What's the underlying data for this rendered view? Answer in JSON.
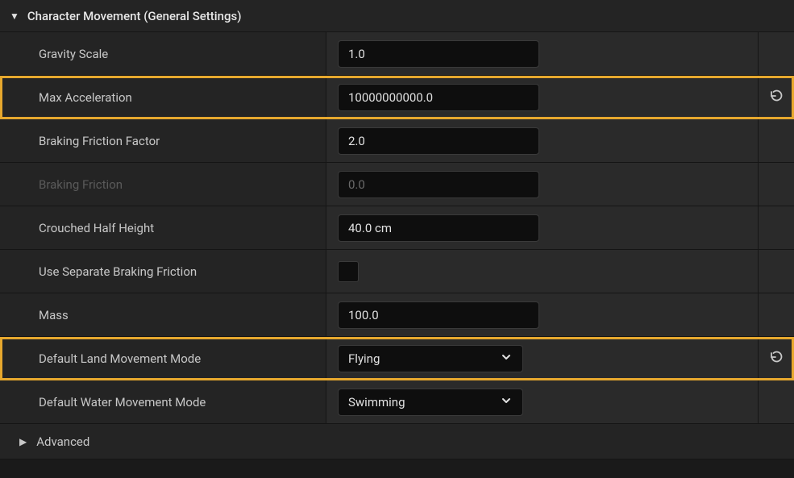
{
  "section": {
    "title": "Character Movement (General Settings)"
  },
  "properties": {
    "gravity_scale": {
      "label": "Gravity Scale",
      "value": "1.0"
    },
    "max_acceleration": {
      "label": "Max Acceleration",
      "value": "10000000000.0"
    },
    "braking_friction_factor": {
      "label": "Braking Friction Factor",
      "value": "2.0"
    },
    "braking_friction": {
      "label": "Braking Friction",
      "value": "0.0"
    },
    "crouched_half_height": {
      "label": "Crouched Half Height",
      "value": "40.0 cm"
    },
    "use_separate_braking_friction": {
      "label": "Use Separate Braking Friction"
    },
    "mass": {
      "label": "Mass",
      "value": "100.0"
    },
    "default_land_movement_mode": {
      "label": "Default Land Movement Mode",
      "value": "Flying"
    },
    "default_water_movement_mode": {
      "label": "Default Water Movement Mode",
      "value": "Swimming"
    }
  },
  "advanced": {
    "label": "Advanced"
  }
}
